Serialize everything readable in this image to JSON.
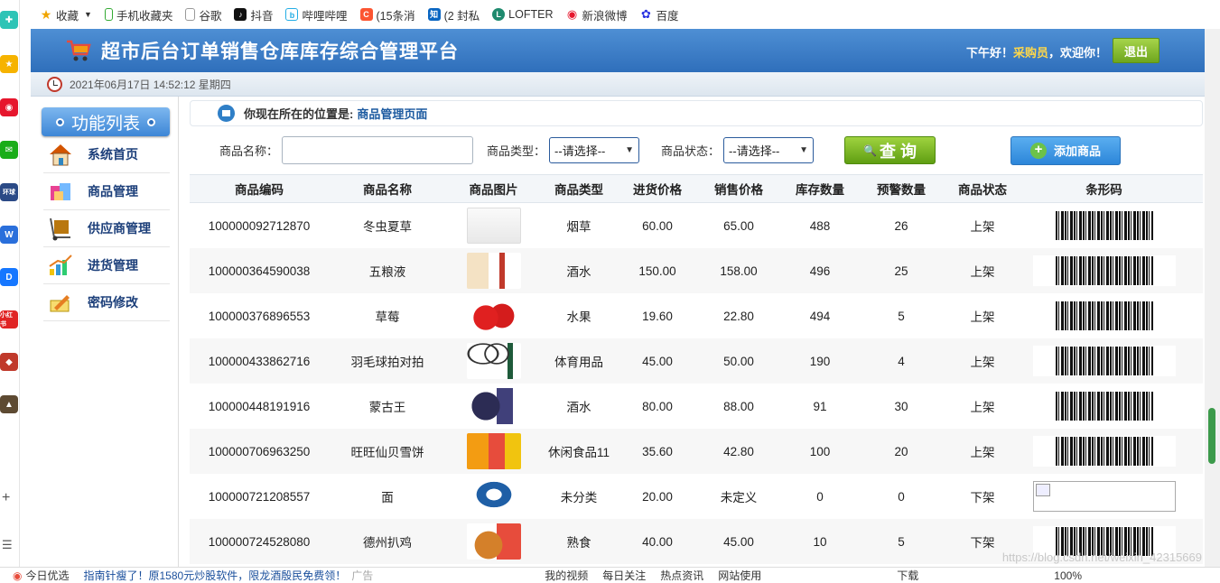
{
  "browser": {
    "bookmarks": [
      "收藏",
      "手机收藏夹",
      "谷歌",
      "抖音",
      "哔哩哔哩",
      "(15条消",
      "(2 封私",
      "LOFTER",
      "新浪微博",
      "百度"
    ],
    "status_left": "今日优选",
    "news": "指南针瘦了！原1580元炒股软件，限龙酒殷民免费领！",
    "news_tag": "广告",
    "status_items": [
      "我的视频",
      "每日关注",
      "热点资讯",
      "网站使用",
      "下载",
      "100%"
    ],
    "watermark": "https://blog.csdn.net/weixin_42315669"
  },
  "header": {
    "title": "超市后台订单销售仓库库存综合管理平台",
    "greeting": "下午好！",
    "role": "采购员",
    "welcome": "，欢迎你！",
    "logout": "退出"
  },
  "datetime": "2021年06月17日 14:52:12 星期四",
  "sidebar": {
    "title": "功能列表",
    "items": [
      {
        "label": "系统首页"
      },
      {
        "label": "商品管理"
      },
      {
        "label": "供应商管理"
      },
      {
        "label": "进货管理"
      },
      {
        "label": "密码修改"
      }
    ]
  },
  "breadcrumb": {
    "prefix": "你现在所在的位置是:",
    "location": "商品管理页面"
  },
  "filter": {
    "name_label": "商品名称：",
    "name_value": "",
    "type_label": "商品类型：",
    "type_selected": "--请选择--",
    "status_label": "商品状态：",
    "status_selected": "--请选择--",
    "query": "查 询",
    "add": "添加商品"
  },
  "table": {
    "headers": [
      "商品编码",
      "商品名称",
      "商品图片",
      "商品类型",
      "进货价格",
      "销售价格",
      "库存数量",
      "预警数量",
      "商品状态",
      "条形码"
    ],
    "rows": [
      {
        "code": "100000092712870",
        "name": "冬虫夏草",
        "type": "烟草",
        "buy": "60.00",
        "sell": "65.00",
        "stock": "488",
        "warn": "26",
        "status": "上架",
        "img": "box-white",
        "barcode": true
      },
      {
        "code": "100000364590038",
        "name": "五粮液",
        "type": "酒水",
        "buy": "150.00",
        "sell": "158.00",
        "stock": "496",
        "warn": "25",
        "status": "上架",
        "img": "liquor",
        "barcode": true
      },
      {
        "code": "100000376896553",
        "name": "草莓",
        "type": "水果",
        "buy": "19.60",
        "sell": "22.80",
        "stock": "494",
        "warn": "5",
        "status": "上架",
        "img": "strawberry",
        "barcode": true
      },
      {
        "code": "100000433862716",
        "name": "羽毛球拍对拍",
        "type": "体育用品",
        "buy": "45.00",
        "sell": "50.00",
        "stock": "190",
        "warn": "4",
        "status": "上架",
        "img": "racket",
        "barcode": true
      },
      {
        "code": "100000448191916",
        "name": "蒙古王",
        "type": "酒水",
        "buy": "80.00",
        "sell": "88.00",
        "stock": "91",
        "warn": "30",
        "status": "上架",
        "img": "jar",
        "barcode": true
      },
      {
        "code": "100000706963250",
        "name": "旺旺仙贝雪饼",
        "type": "休闲食品11",
        "buy": "35.60",
        "sell": "42.80",
        "stock": "100",
        "warn": "20",
        "status": "上架",
        "img": "snack",
        "barcode": true
      },
      {
        "code": "100000721208557",
        "name": "面",
        "type": "未分类",
        "buy": "20.00",
        "sell": "未定义",
        "stock": "0",
        "warn": "0",
        "status": "下架",
        "img": "logo-s",
        "barcode": false
      },
      {
        "code": "100000724528080",
        "name": "德州扒鸡",
        "type": "熟食",
        "buy": "40.00",
        "sell": "45.00",
        "stock": "10",
        "warn": "5",
        "status": "下架",
        "img": "chicken",
        "barcode": true
      }
    ]
  },
  "colors": {
    "header_blue": "#2f6fbb",
    "role_yellow": "#ffd84a",
    "query_green": "#6ea61e",
    "add_blue": "#2c86d9",
    "sidebar_text": "#1c3f7a"
  }
}
